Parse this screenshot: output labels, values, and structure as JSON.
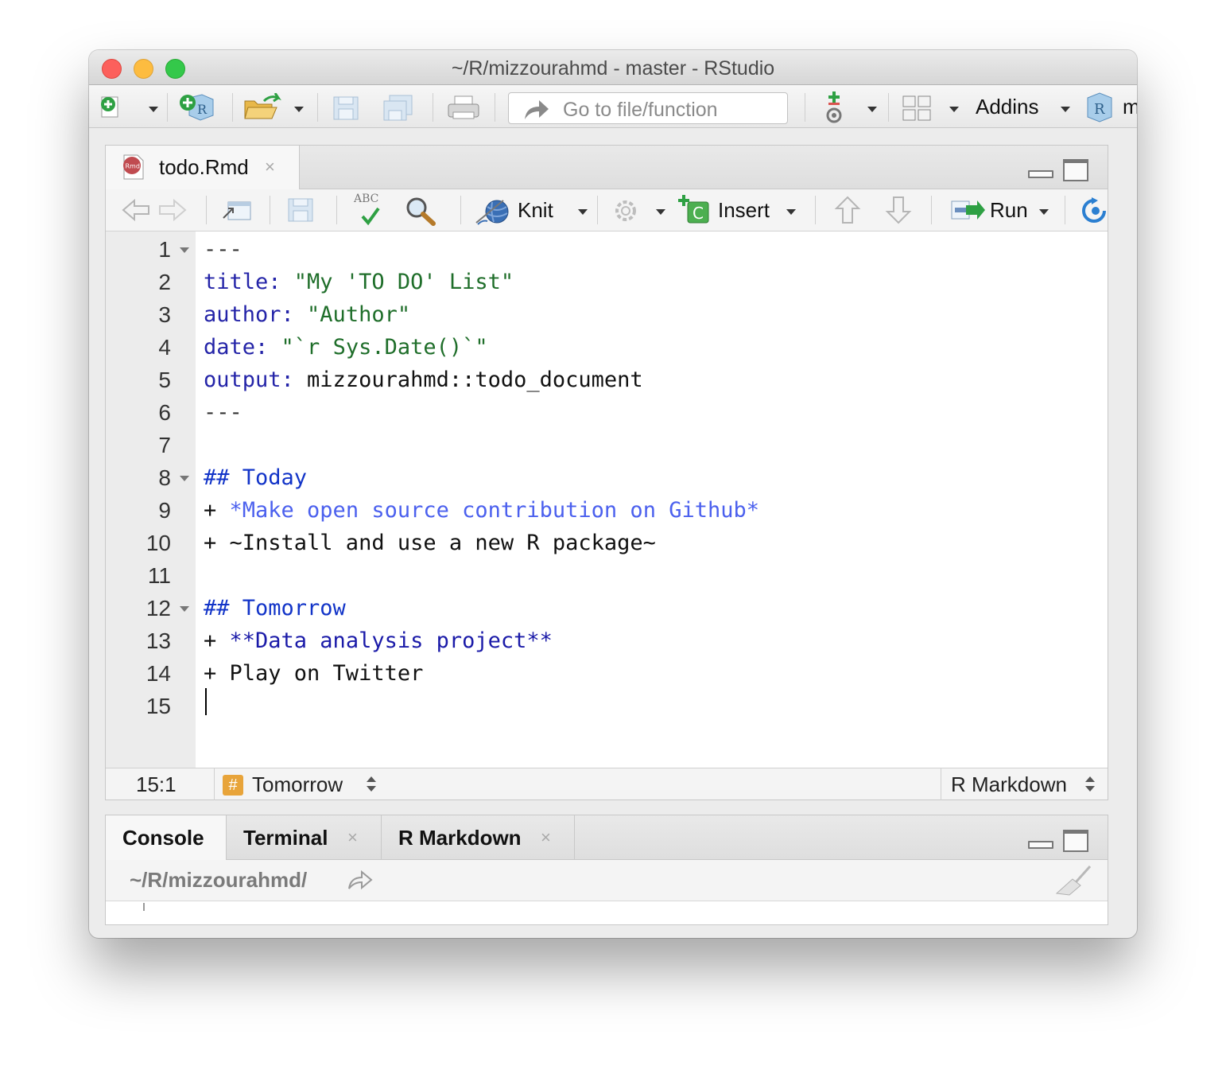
{
  "window": {
    "title": "~/R/mizzourahmd - master - RStudio"
  },
  "main_toolbar": {
    "goto_placeholder": "Go to file/function",
    "addins_label": "Addins",
    "overflow_text": "m"
  },
  "editor": {
    "tab_label": "todo.Rmd",
    "tab_close": "×",
    "knit_label": "Knit",
    "insert_label": "Insert",
    "run_label": "Run",
    "spellcheck_badge": "ABC",
    "lines": [
      {
        "n": "1",
        "fold": true,
        "segments": [
          {
            "c": "d",
            "t": "---"
          }
        ]
      },
      {
        "n": "2",
        "fold": false,
        "segments": [
          {
            "c": "k",
            "t": "title: "
          },
          {
            "c": "s",
            "t": "\"My 'TO DO' List\""
          }
        ]
      },
      {
        "n": "3",
        "fold": false,
        "segments": [
          {
            "c": "k",
            "t": "author: "
          },
          {
            "c": "s",
            "t": "\"Author\""
          }
        ]
      },
      {
        "n": "4",
        "fold": false,
        "segments": [
          {
            "c": "k",
            "t": "date: "
          },
          {
            "c": "s",
            "t": "\"`r Sys.Date()`\""
          }
        ]
      },
      {
        "n": "5",
        "fold": false,
        "segments": [
          {
            "c": "k",
            "t": "output: "
          },
          {
            "c": "p",
            "t": "mizzourahmd::todo_document"
          }
        ]
      },
      {
        "n": "6",
        "fold": false,
        "segments": [
          {
            "c": "d",
            "t": "---"
          }
        ]
      },
      {
        "n": "7",
        "fold": false,
        "segments": []
      },
      {
        "n": "8",
        "fold": true,
        "segments": [
          {
            "c": "h",
            "t": "## Today"
          }
        ]
      },
      {
        "n": "9",
        "fold": false,
        "segments": [
          {
            "c": "p",
            "t": "+ "
          },
          {
            "c": "em",
            "t": "*Make open source contribution on Github*"
          }
        ]
      },
      {
        "n": "10",
        "fold": false,
        "segments": [
          {
            "c": "p",
            "t": "+ ~Install and use a new R package~"
          }
        ]
      },
      {
        "n": "11",
        "fold": false,
        "segments": []
      },
      {
        "n": "12",
        "fold": true,
        "segments": [
          {
            "c": "h",
            "t": "## Tomorrow"
          }
        ]
      },
      {
        "n": "13",
        "fold": false,
        "segments": [
          {
            "c": "p",
            "t": "+ "
          },
          {
            "c": "b",
            "t": "**Data analysis project**"
          }
        ]
      },
      {
        "n": "14",
        "fold": false,
        "segments": [
          {
            "c": "p",
            "t": "+ Play on Twitter"
          }
        ]
      },
      {
        "n": "15",
        "fold": false,
        "segments": []
      }
    ],
    "status": {
      "position": "15:1",
      "section_badge": "#",
      "section": "Tomorrow",
      "mode": "R Markdown"
    }
  },
  "console": {
    "tabs": [
      {
        "label": "Console",
        "closable": false,
        "active": true
      },
      {
        "label": "Terminal",
        "closable": true,
        "active": false
      },
      {
        "label": "R Markdown",
        "closable": true,
        "active": false
      }
    ],
    "tab_close": "×",
    "path": "~/R/mizzourahmd/"
  },
  "colors": {
    "keyword": "#2424a8",
    "string": "#1f6e2a",
    "heading": "#1234c8",
    "emphasis": "#4b60ee"
  }
}
